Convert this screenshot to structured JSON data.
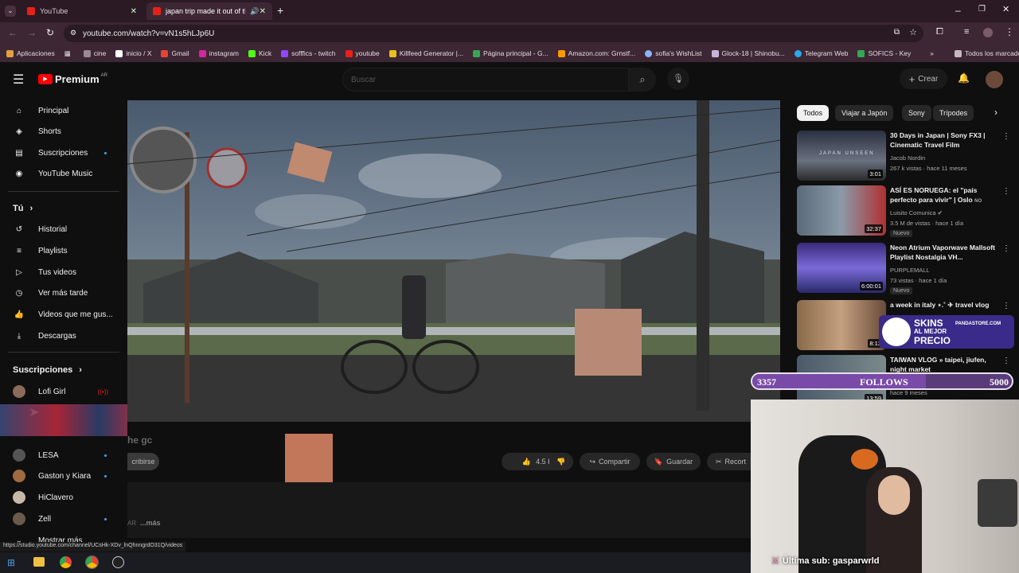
{
  "browser": {
    "tabs": [
      {
        "title": "YouTube",
        "active": false
      },
      {
        "title": "japan trip made it out of th",
        "active": true
      }
    ],
    "url": "youtube.com/watch?v=vN1s5hLJp6U",
    "bookmarks": [
      "Aplicaciones",
      "cine",
      "inicio / X",
      "Gmail",
      "instagram",
      "Kick",
      "sofffics - twitch",
      "youtube",
      "Killfeed Generator |...",
      "Página principal - G...",
      "Amazon.com: Grnstf...",
      "sofia's WishList",
      "Glock-18 | Shinobu...",
      "Telegram Web",
      "SOFICS - Key"
    ],
    "bookmarks_folder": "Todos los marcadores"
  },
  "youtube": {
    "logo": "Premium",
    "country": "AR",
    "search_placeholder": "Buscar",
    "create_label": "Crear",
    "sidebar": {
      "main": [
        "Principal",
        "Shorts",
        "Suscripciones",
        "YouTube Music"
      ],
      "you_heading": "Tú",
      "you": [
        "Historial",
        "Playlists",
        "Tus videos",
        "Ver más tarde",
        "Videos que me gus...",
        "Descargas"
      ],
      "subs_heading": "Suscripciones",
      "subs": [
        "Lofi Girl",
        "LESA",
        "Gaston y Kiara",
        "HiClavero",
        "Zell"
      ],
      "show_more": "Mostrar más"
    },
    "video": {
      "title_fragment": "he gc",
      "subscribe": "cribirse",
      "likes": "4.5 K",
      "share": "Compartir",
      "save": "Guardar",
      "clip": "Recort",
      "more": "...más",
      "desc_prefix": "AR"
    },
    "chips": [
      "Todos",
      "Viajar a Japón",
      "Sony",
      "Trípodes"
    ],
    "recommendations": [
      {
        "title": "30 Days in Japan | Sony FX3 | Cinematic Travel Film",
        "channel": "Jacob Nordin",
        "meta": "267 k vistas · hace 11 meses",
        "duration": "3:01",
        "thumb_text": "JAPAN UNSEEN"
      },
      {
        "title": "ASÍ ES NORUEGA: el \"país perfecto para vivir\" | Oslo",
        "channel": "Luisito Comunica",
        "meta": "3.5 M de vistas · hace 1 día",
        "duration": "32:37",
        "badge": "Nuevo",
        "suffix": "NO"
      },
      {
        "title": "Neon Atrium Vaporwave Mallsoft Playlist  Nostalgia VH...",
        "channel": "PURPLEMALL",
        "meta": "73 vistas · hace 1 día",
        "duration": "6:00:01",
        "badge": "Nuevo"
      },
      {
        "title": "a week in italy ⋆.˚ ✈ travel vlog",
        "channel": "",
        "meta": "",
        "duration": "8:12"
      },
      {
        "title": "TAIWAN VLOG » taipei, jiufen, night market",
        "channel": "",
        "meta": "hace 9 meses",
        "duration": "13:59"
      }
    ]
  },
  "overlay": {
    "follows_current": "3357",
    "follows_label": "FOLLOWS",
    "follows_goal": "5000",
    "follows_progress": 0.67,
    "sponsor_line1": "SKINS",
    "sponsor_line2": "AL MEJOR",
    "sponsor_line3": "PRECIO",
    "sponsor_brand": "PANDASTORE.COM",
    "last_sub": "Última sub: gasparwrld"
  },
  "status_url": "https://studio.youtube.com/channel/UCsHk-XDv_lnQhnngrdO31Q/videos",
  "colors": {
    "accent": "#e62117",
    "follows_bar": "#5a3b7a",
    "chrome": "#3d2734"
  }
}
